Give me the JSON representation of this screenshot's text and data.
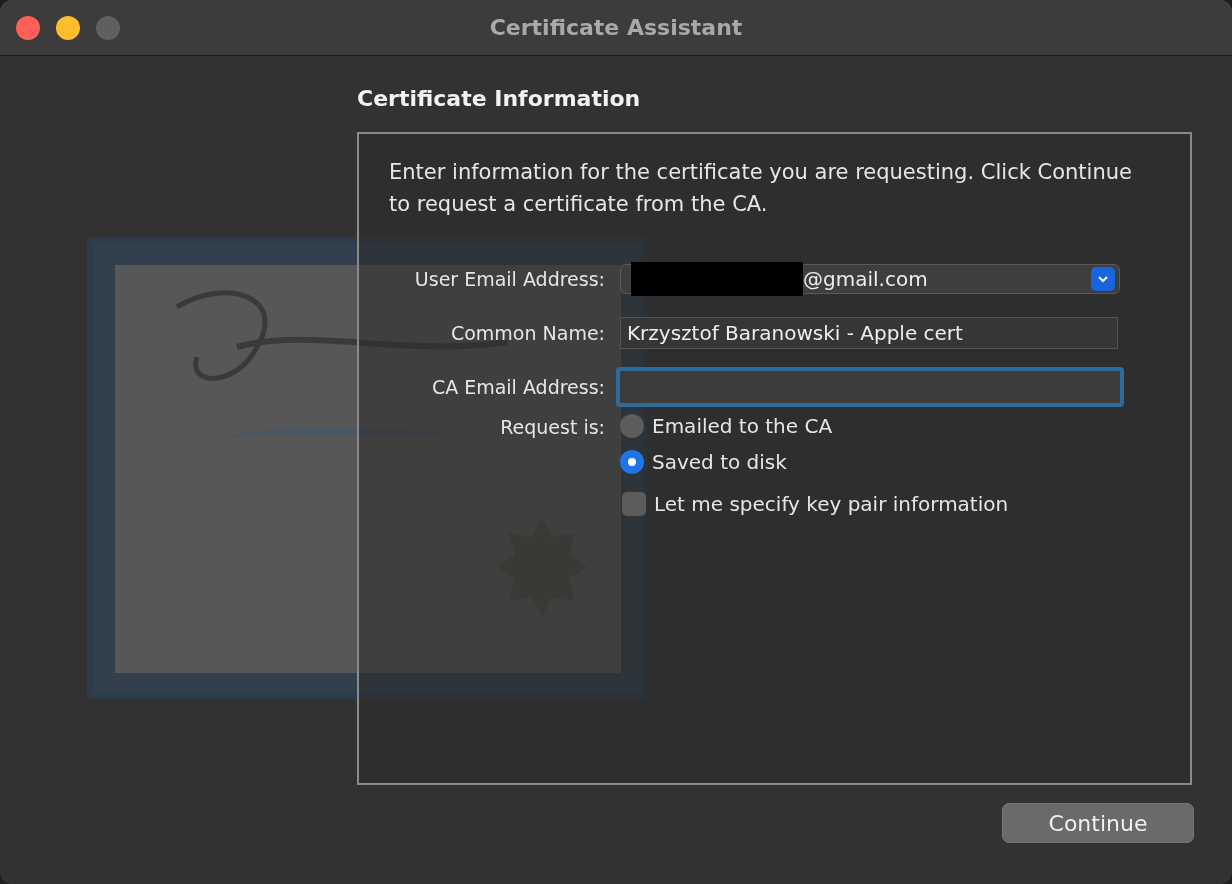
{
  "window": {
    "title": "Certificate Assistant"
  },
  "heading": "Certificate Information",
  "intro": "Enter information for the certificate you are requesting. Click Continue to request a certificate from the CA.",
  "fields": [
    {
      "kind": "popup",
      "label": "User Email Address:",
      "value": "@gmail.com",
      "redacted": true
    },
    {
      "kind": "text",
      "label": "Common Name:",
      "value": "Krzysztof Baranowski - Apple cert",
      "focused": false
    },
    {
      "kind": "text",
      "label": "CA Email Address:",
      "focused": true
    }
  ],
  "request": {
    "label": "Request is:",
    "options": [
      {
        "label": "Emailed to the CA",
        "selected": false
      },
      {
        "label": "Saved to disk",
        "selected": true
      }
    ]
  },
  "key_pair": {
    "label": "Let me specify key pair information",
    "checked": false
  },
  "buttons": [
    {
      "label": "Continue"
    }
  ]
}
